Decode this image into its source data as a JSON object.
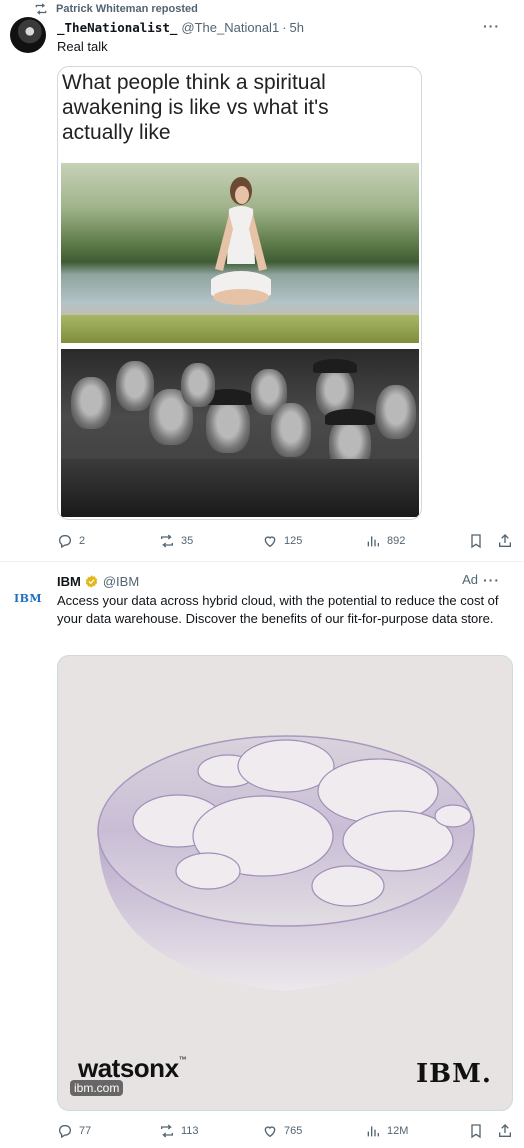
{
  "tweet1": {
    "repost_label": "Patrick Whiteman reposted",
    "author_name": "_TheNationalist_",
    "handle": "@The_National1",
    "time": "5h",
    "text": "Real talk",
    "meme_caption": "What people think a spiritual awakening is like vs what it's actually like",
    "actions": {
      "replies": "2",
      "reposts": "35",
      "likes": "125",
      "views": "892"
    }
  },
  "tweet2": {
    "avatar_text": "IBM",
    "author_name": "IBM",
    "handle": "@IBM",
    "ad_label": "Ad",
    "text": "Access your data across hybrid cloud, with the potential to reduce the cost of your data warehouse. Discover the benefits of our fit-for-purpose data store.",
    "media": {
      "brand_left": "watsonx",
      "trademark": "™",
      "brand_right": "IBM.",
      "url_tag": "ibm.com"
    },
    "actions": {
      "replies": "77",
      "reposts": "113",
      "likes": "765",
      "views": "12M"
    }
  },
  "colors": {
    "text_primary": "#0f1419",
    "text_secondary": "#536471",
    "verified_gold": "#e2b719",
    "ibm_blue": "#1f70c1"
  }
}
